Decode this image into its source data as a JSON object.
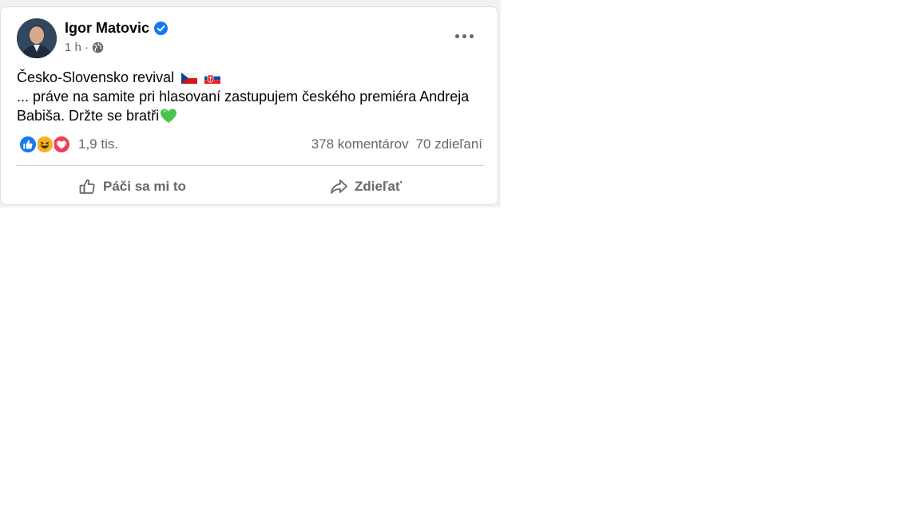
{
  "post": {
    "author": "Igor Matovic",
    "time": "1 h",
    "separator": "·",
    "text_line1": "Česko-Slovensko revival",
    "text_line2": "... práve na samite pri hlasovaní zastupujem českého premiéra Andreja",
    "text_line3": "Babiša. Držte se bratři"
  },
  "reactions": {
    "types": [
      "like-icon",
      "haha-icon",
      "love-icon"
    ],
    "count": "1,9 tis."
  },
  "stats": {
    "comments": "378 komentárov",
    "shares": "70 zdieľaní"
  },
  "actions": {
    "like_label": "Páči sa mi to",
    "share_label": "Zdieľať"
  },
  "colors": {
    "verified": "#1877f2",
    "like": "#1877f2",
    "love": "#f33e58",
    "haha": "#f7b125",
    "heart_emoji": "#49c44f"
  }
}
